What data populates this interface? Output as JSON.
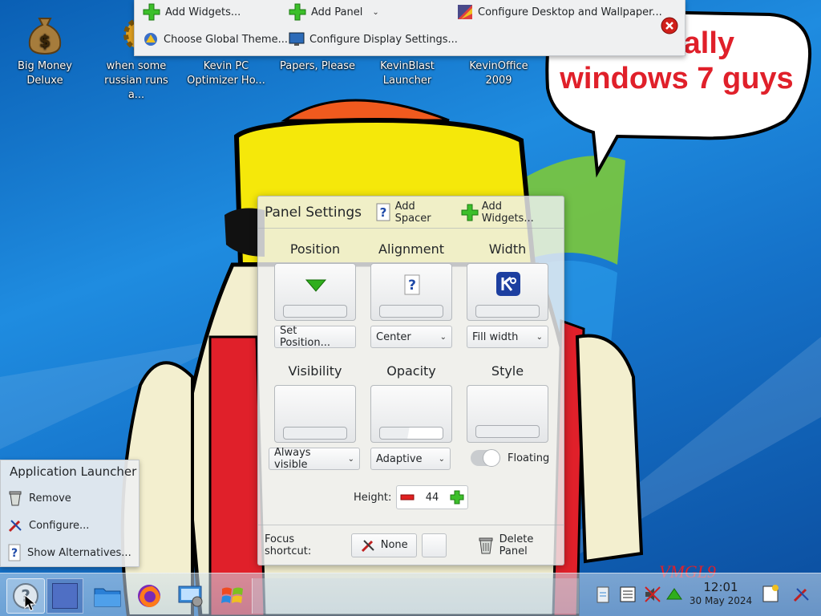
{
  "wallpaper": {
    "bubble_line1": "tally",
    "bubble_line2": "windows 7 guys",
    "watermark": "VMGL9",
    "colors": {
      "sky": "#1f8ce0",
      "bubble_text": "#e0202a",
      "hat": "#f5e80a",
      "shirt": "#e0202a",
      "skin": "#f3efcf"
    }
  },
  "desktop_icons": [
    {
      "label": "Big Money Deluxe",
      "icon": "money-bag-icon"
    },
    {
      "label": "when some russian runs a...",
      "icon": "gear-icon"
    },
    {
      "label": "Kevin PC Optimizer Ho...",
      "icon": "app-icon"
    },
    {
      "label": "Papers, Please",
      "icon": "app-icon"
    },
    {
      "label": "KevinBlast Launcher",
      "icon": "app-icon"
    },
    {
      "label": "KevinOffice 2009",
      "icon": "app-icon"
    }
  ],
  "desktop_menu": {
    "add_widgets": "Add Widgets...",
    "add_panel": "Add Panel",
    "configure_desktop": "Configure Desktop and Wallpaper...",
    "global_theme": "Choose Global Theme...",
    "display_settings": "Configure Display Settings..."
  },
  "panel_settings": {
    "title": "Panel Settings",
    "add_spacer": "Add Spacer",
    "add_widgets": "Add Widgets...",
    "sections": {
      "position": {
        "label": "Position",
        "value": "Set Position..."
      },
      "alignment": {
        "label": "Alignment",
        "value": "Center"
      },
      "width": {
        "label": "Width",
        "value": "Fill width"
      },
      "visibility": {
        "label": "Visibility",
        "value": "Always visible"
      },
      "opacity": {
        "label": "Opacity",
        "value": "Adaptive"
      },
      "style": {
        "label": "Style",
        "toggle_label": "Floating",
        "floating": false
      }
    },
    "height_label": "Height:",
    "height_value": "44",
    "focus_label": "Focus shortcut:",
    "focus_value": "None",
    "delete_panel": "Delete Panel"
  },
  "launcher_menu": {
    "title": "Application Launcher",
    "items": [
      "Remove",
      "Configure...",
      "Show Alternatives..."
    ]
  },
  "taskbar": {
    "time": "12:01",
    "date": "30 May 2024"
  }
}
